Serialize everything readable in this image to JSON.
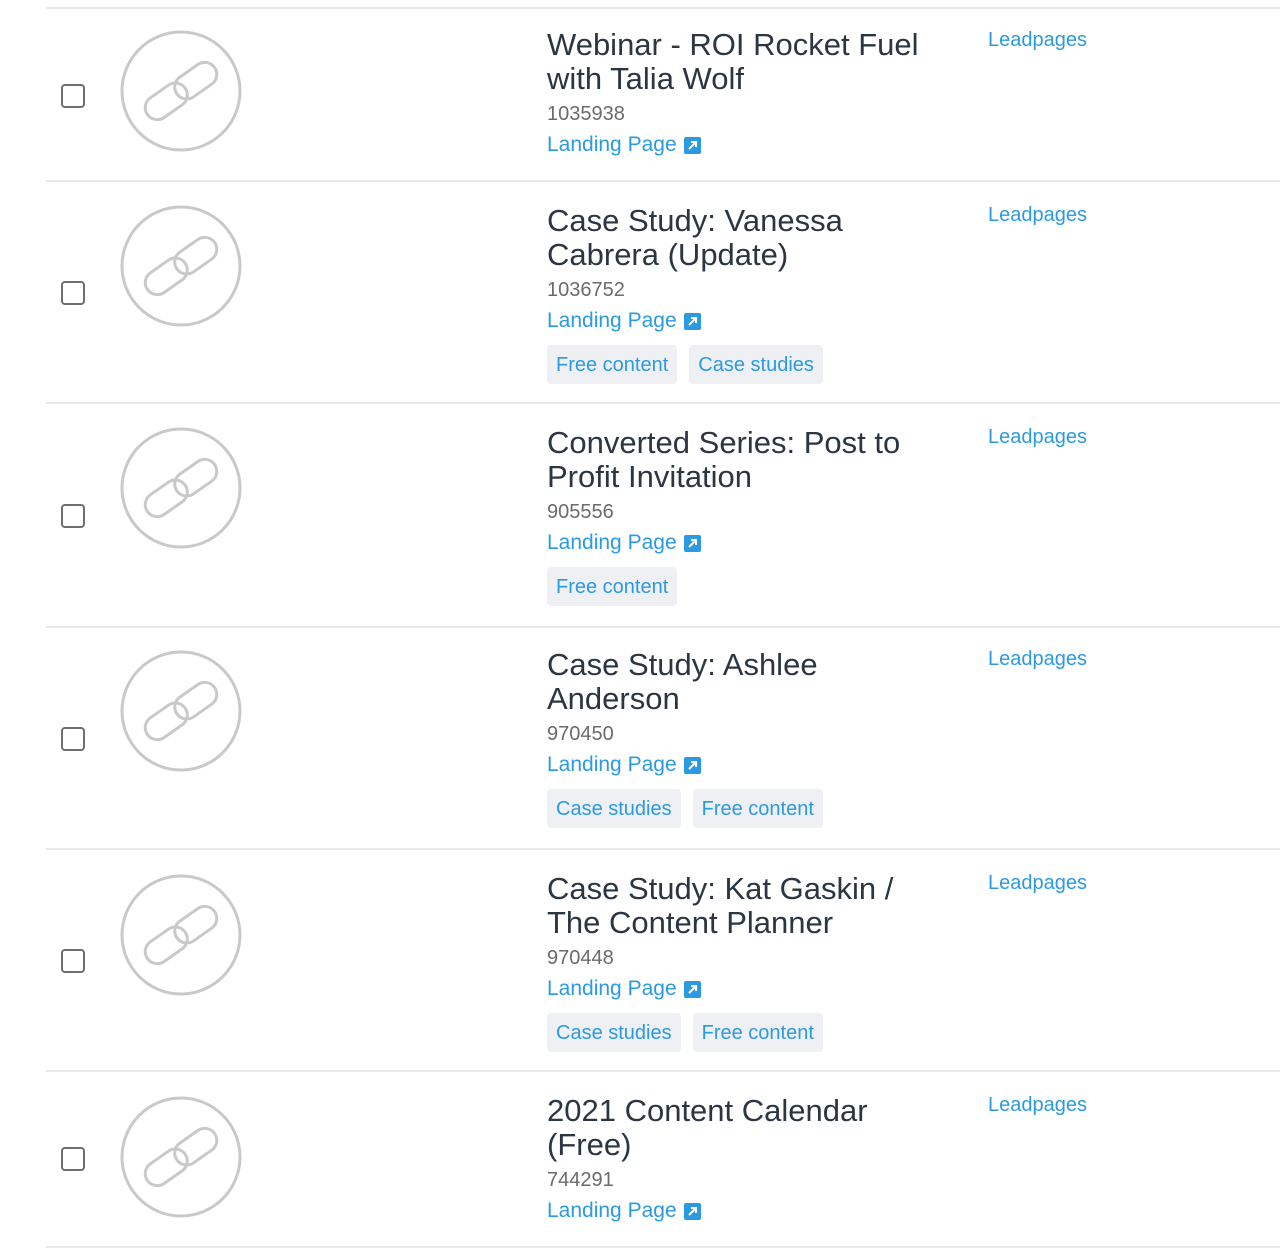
{
  "rows": [
    {
      "title": "Webinar - ROI Rocket Fuel with Talia Wolf",
      "id": "1035938",
      "type_label": "Landing Page",
      "source": "Leadpages",
      "tags": []
    },
    {
      "title": "Case Study: Vanessa Cabrera (Update)",
      "id": "1036752",
      "type_label": "Landing Page",
      "source": "Leadpages",
      "tags": [
        "Free content",
        "Case studies"
      ]
    },
    {
      "title": "Converted Series: Post to Profit Invitation",
      "id": "905556",
      "type_label": "Landing Page",
      "source": "Leadpages",
      "tags": [
        "Free content"
      ]
    },
    {
      "title": "Case Study: Ashlee Anderson",
      "id": "970450",
      "type_label": "Landing Page",
      "source": "Leadpages",
      "tags": [
        "Case studies",
        "Free content"
      ]
    },
    {
      "title": "Case Study: Kat Gaskin / The Content Planner",
      "id": "970448",
      "type_label": "Landing Page",
      "source": "Leadpages",
      "tags": [
        "Case studies",
        "Free content"
      ]
    },
    {
      "title": "2021 Content Calendar (Free)",
      "id": "744291",
      "type_label": "Landing Page",
      "source": "Leadpages",
      "tags": []
    }
  ],
  "icons": {
    "thumbnail": "link-chain-icon",
    "type_link": "external-link-icon"
  },
  "colors": {
    "link": "#2b9ae1",
    "title": "#2c3642",
    "tag_bg": "#eef0f3",
    "divider": "#e8e8e8"
  }
}
